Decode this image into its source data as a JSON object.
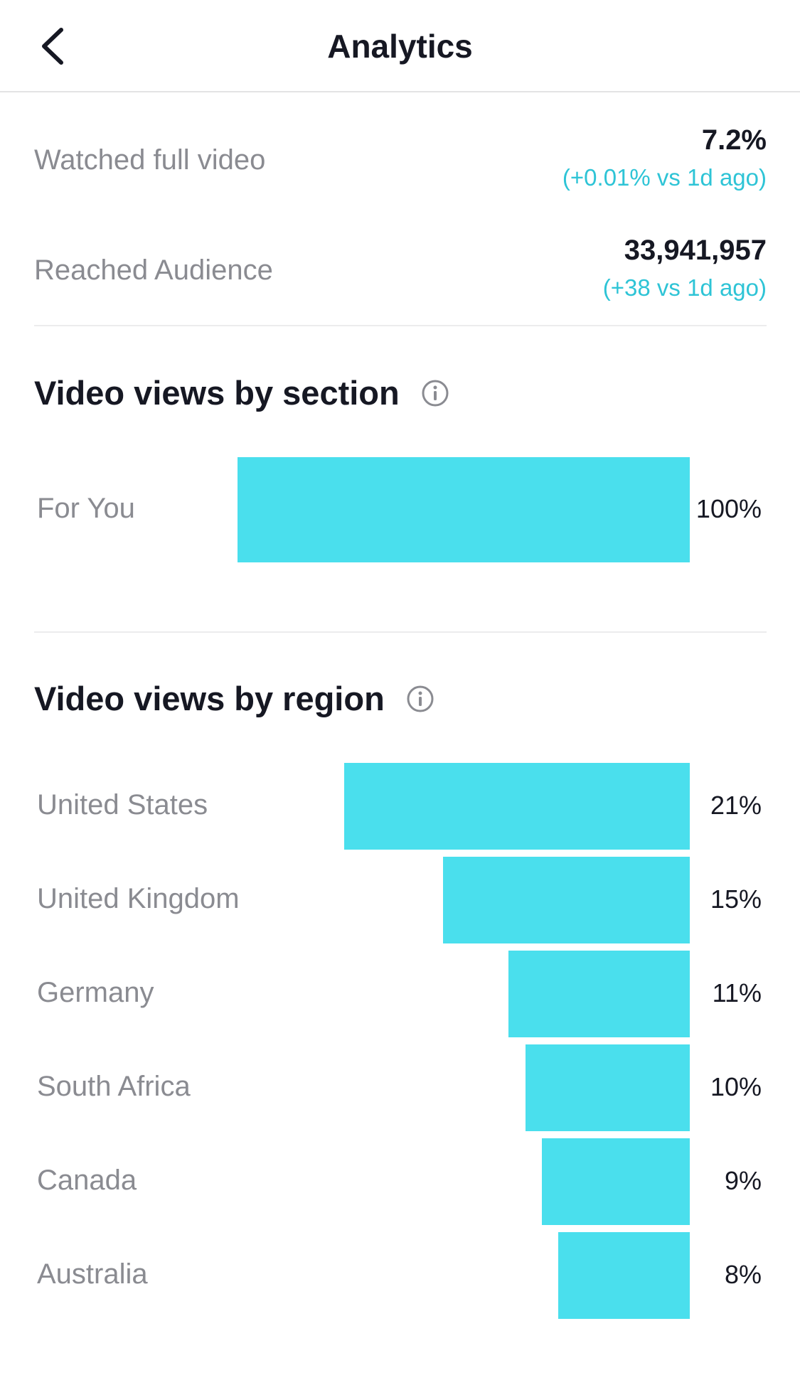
{
  "header": {
    "title": "Analytics",
    "back_icon": "chevron-left-icon"
  },
  "metrics": [
    {
      "label": "Watched full video",
      "value": "7.2%",
      "delta": "(+0.01% vs 1d ago)"
    },
    {
      "label": "Reached Audience",
      "value": "33,941,957",
      "delta": "(+38 vs 1d ago)"
    }
  ],
  "sections": {
    "by_section": {
      "title": "Video views by section",
      "icon": "info-icon"
    },
    "by_region": {
      "title": "Video views by region",
      "icon": "info-icon"
    }
  },
  "colors": {
    "bar": "#4adfed",
    "delta": "#2ec4d6",
    "label": "#8a8b91"
  },
  "chart_data": [
    {
      "type": "bar",
      "orientation": "horizontal",
      "title": "Video views by section",
      "categories": [
        "For You"
      ],
      "values": [
        100
      ],
      "value_labels": [
        "100%"
      ]
    },
    {
      "type": "bar",
      "orientation": "horizontal",
      "title": "Video views by region",
      "categories": [
        "United States",
        "United Kingdom",
        "Germany",
        "South Africa",
        "Canada",
        "Australia"
      ],
      "values": [
        21,
        15,
        11,
        10,
        9,
        8
      ],
      "value_labels": [
        "21%",
        "15%",
        "11%",
        "10%",
        "9%",
        "8%"
      ]
    }
  ]
}
